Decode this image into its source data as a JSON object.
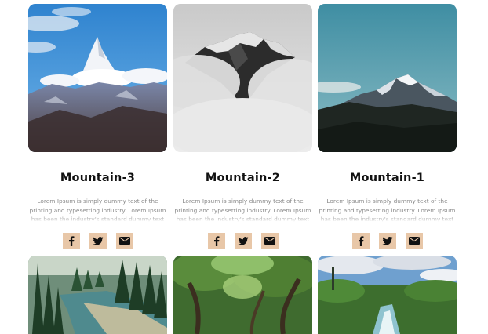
{
  "cards": [
    {
      "title": "Mountain-3",
      "description": "Lorem Ipsum is simply dummy text of the printing and typesetting industry. Lorem Ipsum has been the industry's standard dummy text"
    },
    {
      "title": "Mountain-2",
      "description": "Lorem Ipsum is simply dummy text of the printing and typesetting industry. Lorem Ipsum has been the industry's standard dummy text"
    },
    {
      "title": "Mountain-1",
      "description": "Lorem Ipsum is simply dummy text of the printing and typesetting industry. Lorem Ipsum has been the industry's standard dummy text"
    }
  ],
  "social_icons": [
    "facebook-icon",
    "twitter-icon",
    "email-icon"
  ],
  "colors": {
    "social_button_bg": "#e8c7a8",
    "title": "#111111",
    "description": "#8a8a8a"
  }
}
